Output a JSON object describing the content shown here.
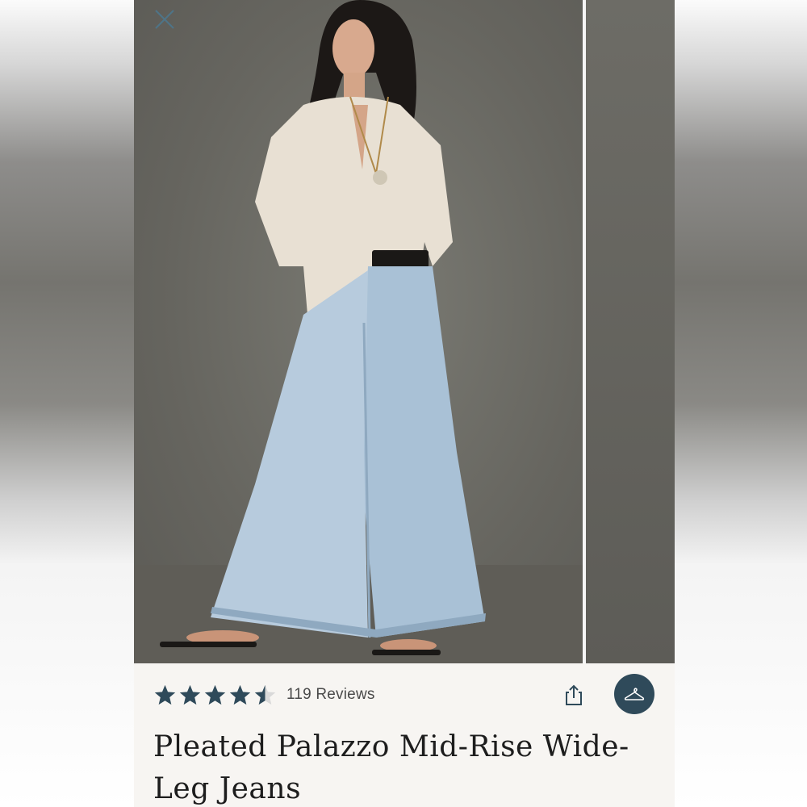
{
  "product": {
    "title": "Pleated Palazzo Mid-Rise Wide-Leg Jeans",
    "rating": 4.5,
    "reviews_label": "119 Reviews"
  },
  "icons": {
    "close": "close-icon",
    "share": "share-icon",
    "hanger": "hanger-icon",
    "star": "star-icon"
  },
  "colors": {
    "star": "#2f4a5a",
    "hanger_button": "#2f4a5a",
    "title": "#1d1d1d"
  }
}
